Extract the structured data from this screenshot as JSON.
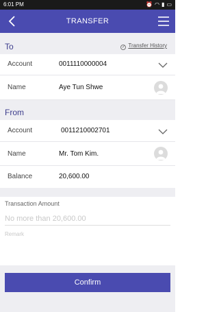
{
  "status_bar": {
    "time": "6:01 PM"
  },
  "header": {
    "title": "TRANSFER"
  },
  "to_section": {
    "label": "To",
    "history_link": "Transfer History",
    "account_label": "Account",
    "account_value": "0011110000004",
    "name_label": "Name",
    "name_value": "Aye Tun Shwe"
  },
  "from_section": {
    "label": "From",
    "account_label": "Account",
    "account_value": "0011210002701",
    "name_label": "Name",
    "name_value": "Mr. Tom Kim.",
    "balance_label": "Balance",
    "balance_value": "20,600.00"
  },
  "transaction": {
    "amount_label": "Transaction Amount",
    "amount_placeholder": "No more than 20,600.00",
    "remark_placeholder": "Remark"
  },
  "confirm_label": "Confirm",
  "colors": {
    "primary": "#4a4bb0",
    "section_bg": "#eeeef2",
    "section_label": "#3c3c8c"
  }
}
